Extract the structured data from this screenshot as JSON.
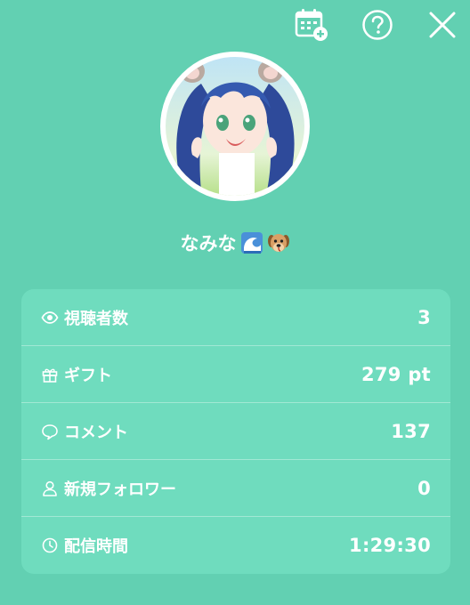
{
  "header": {
    "calendar_icon": "calendar-add-icon",
    "help_icon": "question-circle-icon",
    "close_icon": "close-icon"
  },
  "profile": {
    "name": "なみな",
    "emoji_icons": [
      "wave-emoji",
      "dog-face-emoji"
    ]
  },
  "stats": [
    {
      "icon": "eye-icon",
      "label": "視聴者数",
      "value": "3"
    },
    {
      "icon": "gift-icon",
      "label": "ギフト",
      "value": "279 pt"
    },
    {
      "icon": "comment-icon",
      "label": "コメント",
      "value": "137"
    },
    {
      "icon": "person-icon",
      "label": "新規フォロワー",
      "value": "0"
    },
    {
      "icon": "clock-icon",
      "label": "配信時間",
      "value": "1:29:30"
    }
  ],
  "colors": {
    "background": "#62d0b2",
    "card": "#6fdcbe",
    "text": "#ffffff"
  }
}
